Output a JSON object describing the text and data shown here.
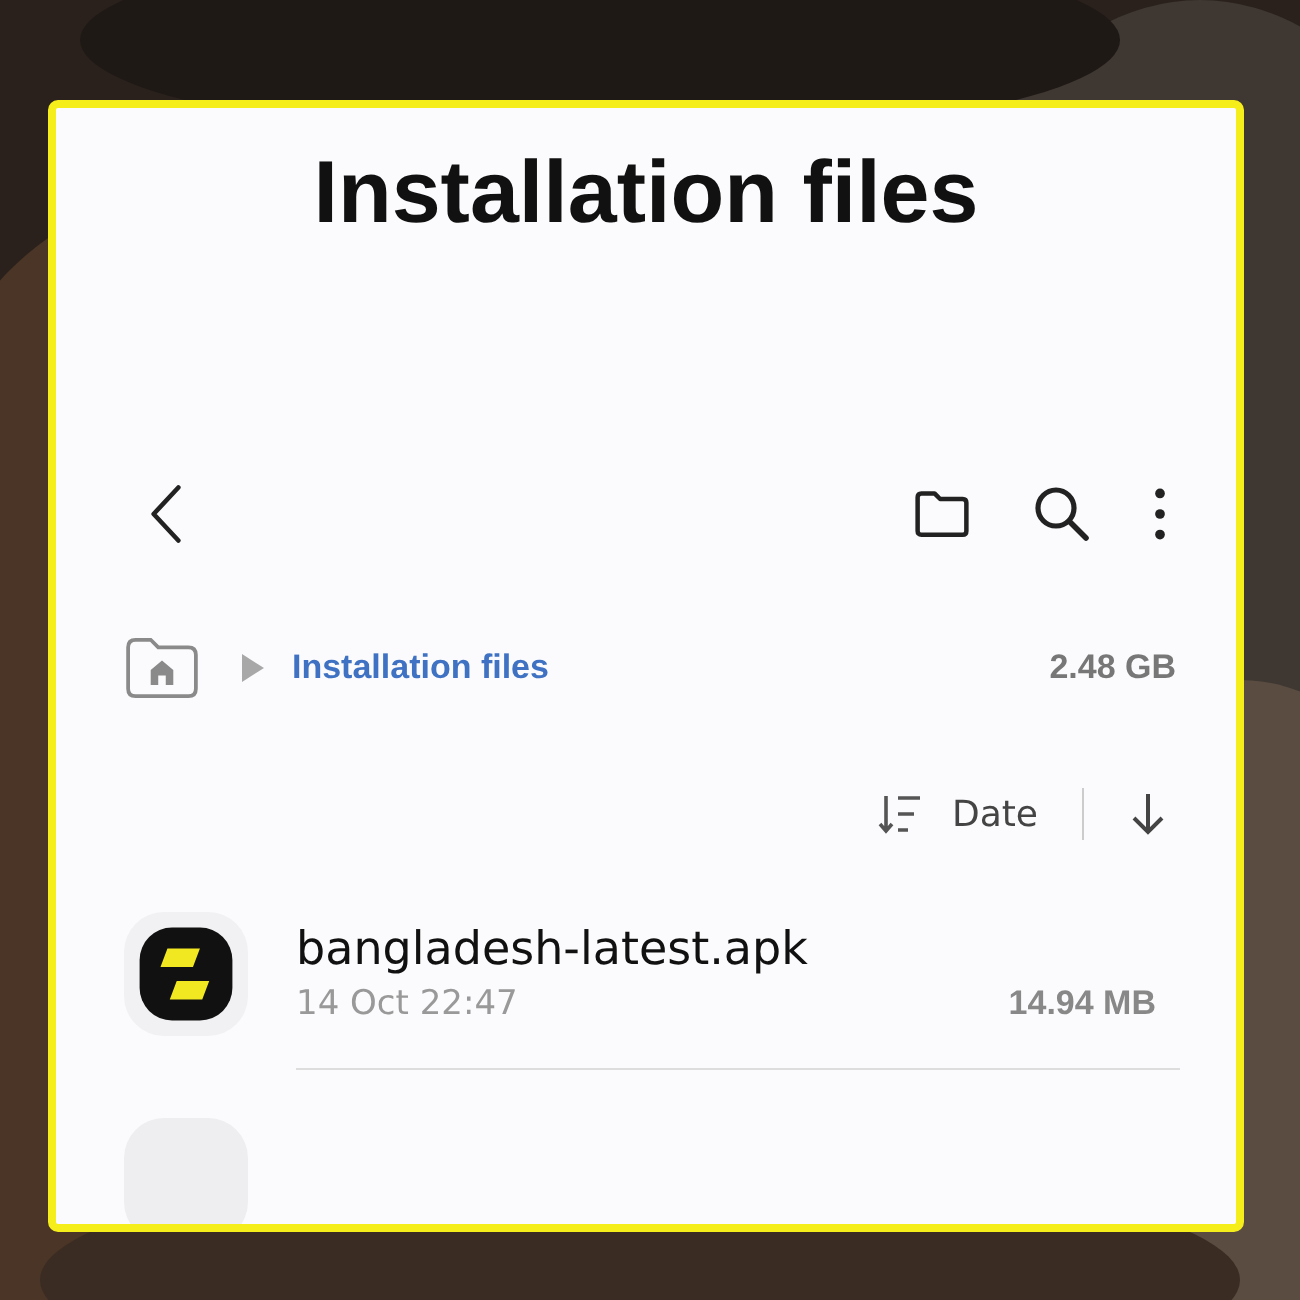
{
  "title": "Installation files",
  "breadcrumb": {
    "folder": "Installation files",
    "size": "2.48 GB"
  },
  "sort": {
    "label": "Date"
  },
  "files": [
    {
      "name": "bangladesh-latest.apk",
      "date": "14 Oct 22:47",
      "size": "14.94 MB"
    }
  ]
}
